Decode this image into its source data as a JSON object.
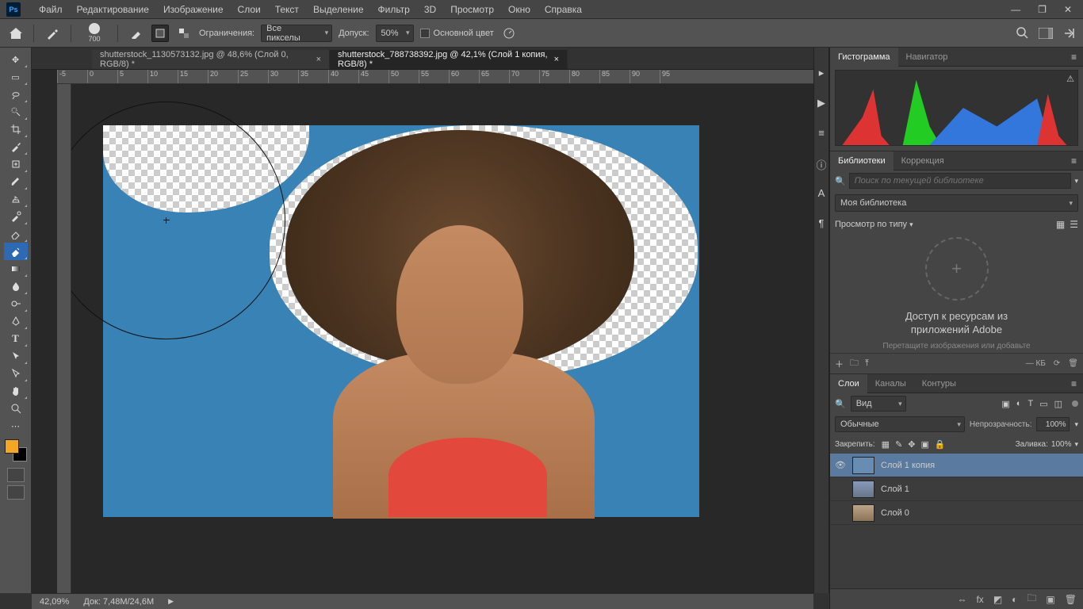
{
  "menu": {
    "items": [
      "Файл",
      "Редактирование",
      "Изображение",
      "Слои",
      "Текст",
      "Выделение",
      "Фильтр",
      "3D",
      "Просмотр",
      "Окно",
      "Справка"
    ]
  },
  "options": {
    "brush_size": "700",
    "limits_label": "Ограничения:",
    "limits_value": "Все пикселы",
    "tolerance_label": "Допуск:",
    "tolerance_value": "50%",
    "bgcolor_label": "Основной цвет"
  },
  "tabs": [
    {
      "label": "shutterstock_1130573132.jpg @ 48,6% (Слой 0, RGB/8) *"
    },
    {
      "label": "shutterstock_788738392.jpg @ 42,1% (Слой 1 копия, RGB/8) *"
    }
  ],
  "ruler": [
    "-5",
    "0",
    "5",
    "10",
    "15",
    "20",
    "25",
    "30",
    "35",
    "40",
    "45",
    "50",
    "55",
    "60",
    "65",
    "70",
    "75",
    "80",
    "85",
    "90",
    "95"
  ],
  "panels": {
    "histogram_tab": "Гистограмма",
    "navigator_tab": "Навигатор",
    "libraries_tab": "Библиотеки",
    "adjustments_tab": "Коррекция",
    "search_placeholder": "Поиск по текущей библиотеке",
    "my_library": "Моя библиотека",
    "view_by": "Просмотр по типу",
    "lib_line1": "Доступ к ресурсам из",
    "lib_line2": "приложений Adobe",
    "lib_sub": "Перетащите изображения или добавьте",
    "lib_size": "— КБ",
    "layers_tab": "Слои",
    "channels_tab": "Каналы",
    "paths_tab": "Контуры",
    "kind": "Вид",
    "blend": "Обычные",
    "opacity_label": "Непрозрачность:",
    "opacity_value": "100%",
    "lock_label": "Закрепить:",
    "fill_label": "Заливка:",
    "fill_value": "100%"
  },
  "layers": [
    {
      "name": "Слой 1 копия",
      "visible": true
    },
    {
      "name": "Слой 1",
      "visible": false
    },
    {
      "name": "Слой 0",
      "visible": false
    }
  ],
  "status": {
    "zoom": "42,09%",
    "docinfo": "Док: 7,48M/24,6M"
  }
}
